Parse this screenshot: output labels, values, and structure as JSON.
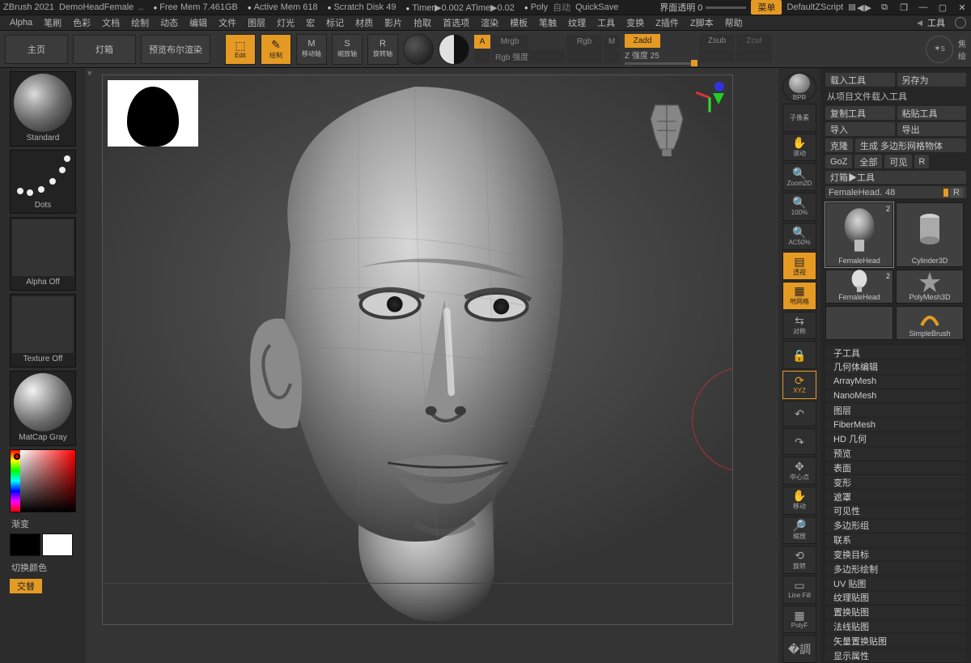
{
  "title": {
    "app": "ZBrush 2021",
    "project": "DemoHeadFemale",
    "dots": "..",
    "freeMem": "Free Mem 7.461GB",
    "activeMem": "Active Mem 618",
    "scratch": "Scratch Disk 49",
    "timer": "Timer▶0.002 ATime▶0.02",
    "poly": "Poly",
    "auto": "自动",
    "quickSave": "QuickSave",
    "transparency": "界面透明 0",
    "menuBtn": "菜单",
    "defaultScript": "DefaultZScript"
  },
  "menu": [
    "Alpha",
    "笔刷",
    "色彩",
    "文档",
    "绘制",
    "动态",
    "编辑",
    "文件",
    "图层",
    "灯光",
    "宏",
    "标记",
    "材质",
    "影片",
    "拾取",
    "首选项",
    "渲染",
    "模板",
    "笔触",
    "纹理",
    "工具",
    "变换",
    "Z插件",
    "Z脚本",
    "帮助"
  ],
  "toolHeader": {
    "title": "工具"
  },
  "shelf": {
    "home": "主页",
    "lightbox": "灯箱",
    "preview": "预览布尔渲染",
    "edit": "Edit",
    "draw": "绘制",
    "move": "移动轴",
    "scale": "缩放轴",
    "rotate": "旋转轴",
    "a": "A",
    "mrgb": "Mrgb",
    "rgb": "Rgb",
    "m": "M",
    "rgbIntensity": "Rgb 强度",
    "zadd": "Zadd",
    "zsub": "Zsub",
    "zcut": "Zcut",
    "zIntensity": "Z 强度 25",
    "focal": "焦",
    "sLabel": "S",
    "renderBtn": "绘"
  },
  "left": {
    "standard": "Standard",
    "dots": "Dots",
    "alphaOff": "Alpha Off",
    "textureOff": "Texture Off",
    "matcap": "MatCap Gray",
    "gradient": "渐变",
    "switchColors": "切换颜色",
    "swap": "交替"
  },
  "gutter": {
    "bpr": "BPR",
    "subpixel": "子像素",
    "shake": "滚动",
    "zoom2d": "Zoom2D",
    "p100": "100%",
    "ac50": "AC50%",
    "persp": "透视",
    "floor": "地网格",
    "sym": "对称",
    "lock": "",
    "xyz": "XYZ",
    "rotL": "",
    "rotR": "",
    "center": "中心点",
    "move": "移动",
    "zoom": "缩放",
    "spin": "旋转",
    "lineFill": "Line Fill",
    "polyF": "PolyF",
    "extra": ""
  },
  "right": {
    "load": "载入工具",
    "saveAs": "另存为",
    "loadProject": "从项目文件载入工具",
    "copy": "复制工具",
    "paste": "粘贴工具",
    "import": "导入",
    "export": "导出",
    "clone": "克隆",
    "makePoly": "生成 多边形网格物体",
    "goz": "GoZ",
    "all": "全部",
    "visible": "可见",
    "r": "R",
    "lightboxTools": "灯箱▶工具",
    "toolName": "FemaleHead.",
    "toolIndex": "48",
    "r2": "R",
    "cells": [
      {
        "label": "FemaleHead",
        "badge": "2",
        "kind": "head",
        "sel": true
      },
      {
        "label": "Cylinder3D",
        "kind": "cyl"
      },
      {
        "label": "FemaleHead",
        "badge": "2",
        "kind": "head"
      },
      {
        "label": "PolyMesh3D",
        "kind": "star"
      },
      {
        "label": "",
        "kind": "head-small"
      },
      {
        "label": "SimpleBrush",
        "kind": "brush"
      }
    ],
    "subpanels": [
      "子工具",
      "几何体编辑",
      "ArrayMesh",
      "NanoMesh",
      "图层",
      "FiberMesh",
      "HD 几何",
      "预览",
      "表面",
      "变形",
      "遮罩",
      "可见性",
      "多边形组",
      "联系",
      "变换目标",
      "多边形绘制",
      "UV 贴图",
      "纹理贴图",
      "置换贴图",
      "法线贴图",
      "矢量置换贴图",
      "显示属性"
    ]
  }
}
